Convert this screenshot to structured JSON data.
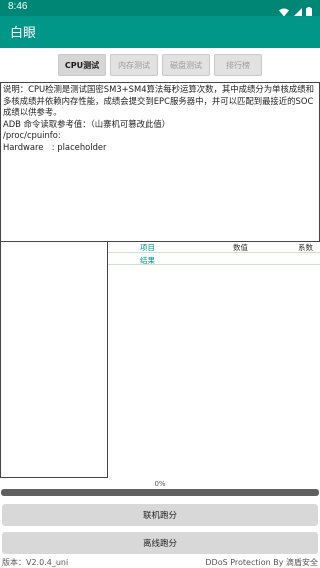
{
  "status_bar": {
    "time": "8:46"
  },
  "app_bar": {
    "title": "白眼"
  },
  "tabs": [
    {
      "label": "CPU测试",
      "active": true
    },
    {
      "label": "内存测试",
      "active": false
    },
    {
      "label": "磁盘测试",
      "active": false
    },
    {
      "label": "排行榜",
      "active": false
    }
  ],
  "description": {
    "line1": "说明：CPU检测是测试国密SM3+SM4算法每秒运算次数，其中成绩分为单核成绩和多核成绩并依赖内存性能，成绩会提交到EPC服务器中，并可以匹配到最接近的SOC成绩以供参考。",
    "line2": "ADB 命令读取参考值：（山寨机可篡改此值）",
    "line3": "/proc/cpuinfo:",
    "line4": "Hardware　: placeholder"
  },
  "results_table": {
    "col_item": "项目",
    "col_value": "数值",
    "col_coef": "系数",
    "result_label": "结果"
  },
  "progress": {
    "text": "0%",
    "value": 0
  },
  "buttons": {
    "online_run": "联机跑分",
    "offline_run": "离线跑分"
  },
  "footer": {
    "version": "版本：V2.0.4_uni",
    "protection": "DDoS Protection By 滴盾安全"
  }
}
